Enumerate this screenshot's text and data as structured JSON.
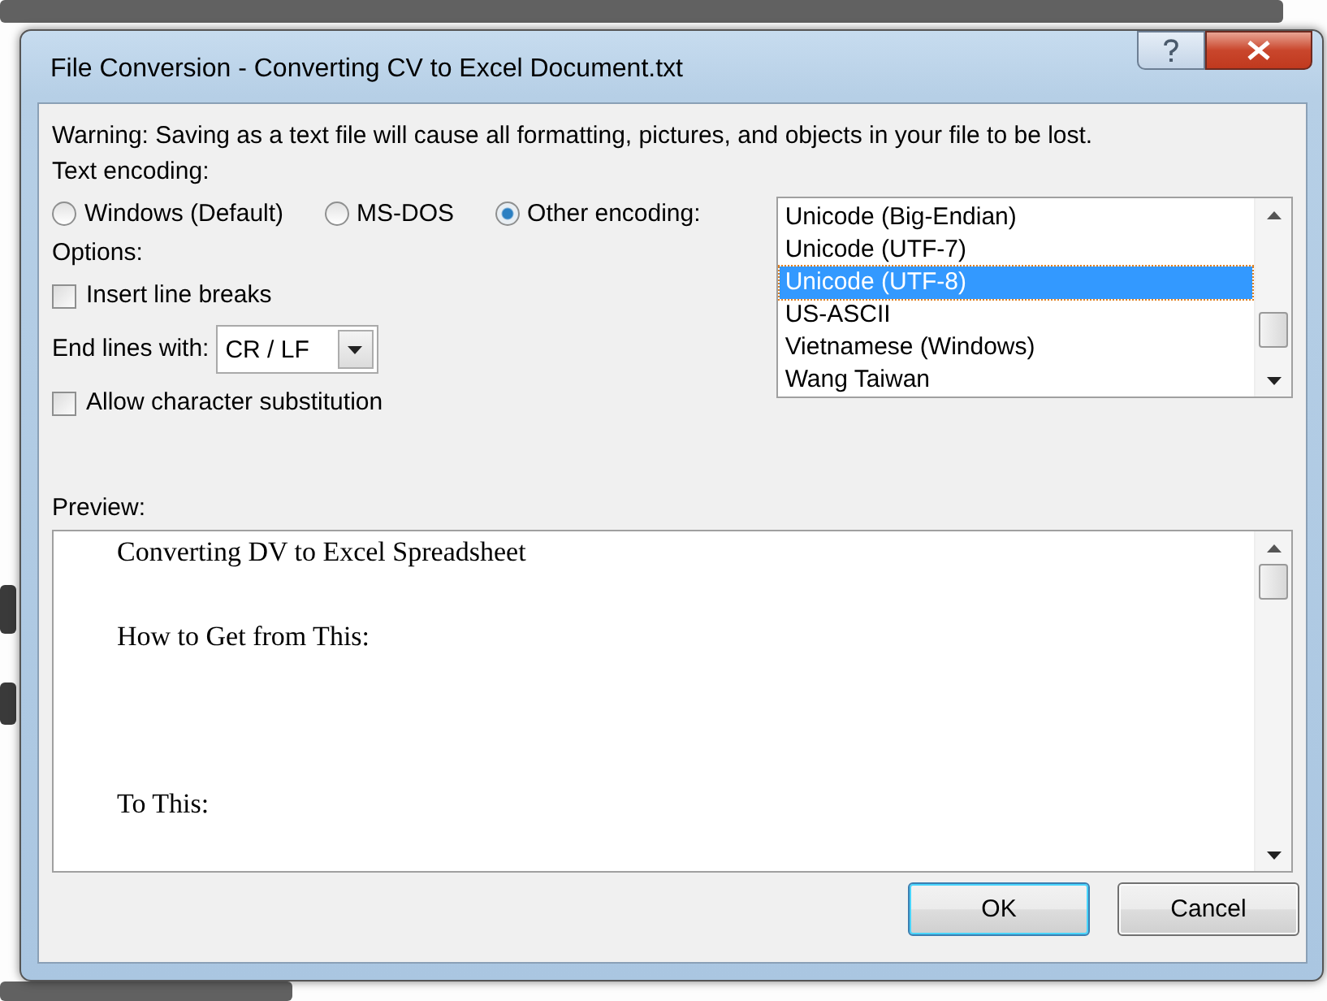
{
  "window": {
    "title": "File Conversion - Converting CV to Excel Document.txt"
  },
  "warning": "Warning: Saving as a text file will cause all formatting, pictures, and objects in your file to be lost.",
  "text_encoding": {
    "label": "Text encoding:",
    "options": [
      {
        "label": "Windows (Default)",
        "selected": false
      },
      {
        "label": "MS-DOS",
        "selected": false
      },
      {
        "label": "Other encoding:",
        "selected": true
      }
    ]
  },
  "options": {
    "label": "Options:",
    "insert_line_breaks": {
      "label": "Insert line breaks",
      "checked": false
    },
    "end_lines": {
      "label": "End lines with:",
      "value": "CR / LF"
    },
    "allow_substitution": {
      "label": "Allow character substitution",
      "checked": false
    }
  },
  "encodings": [
    {
      "label": "Unicode (Big-Endian)",
      "selected": false
    },
    {
      "label": "Unicode (UTF-7)",
      "selected": false
    },
    {
      "label": "Unicode (UTF-8)",
      "selected": true
    },
    {
      "label": "US-ASCII",
      "selected": false
    },
    {
      "label": "Vietnamese (Windows)",
      "selected": false
    },
    {
      "label": "Wang Taiwan",
      "selected": false
    }
  ],
  "preview": {
    "label": "Preview:",
    "lines": [
      "Converting DV to Excel Spreadsheet",
      "How to Get from This:",
      "To This:"
    ]
  },
  "buttons": [
    {
      "label": "OK",
      "default": true
    },
    {
      "label": "Cancel",
      "default": false
    }
  ]
}
